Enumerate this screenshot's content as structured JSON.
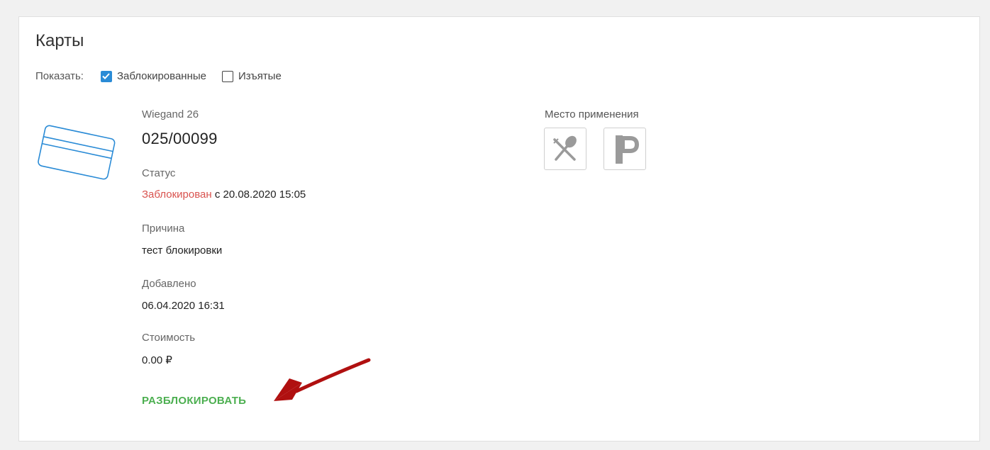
{
  "section": {
    "title": "Карты"
  },
  "filters": {
    "label": "Показать:",
    "blocked": {
      "label": "Заблокированные",
      "checked": true
    },
    "withdrawn": {
      "label": "Изъятые",
      "checked": false
    }
  },
  "card": {
    "type": "Wiegand 26",
    "number": "025/00099",
    "status_label": "Статус",
    "status_value": "Заблокирован",
    "status_since": "с 20.08.2020 15:05",
    "reason_label": "Причина",
    "reason_value": "тест блокировки",
    "added_label": "Добавлено",
    "added_value": "06.04.2020 16:31",
    "cost_label": "Стоимость",
    "cost_value": "0.00 ₽",
    "unblock_label": "РАЗБЛОКИРОВАТЬ"
  },
  "usage": {
    "label": "Место применения",
    "places": [
      {
        "icon": "restaurant-icon"
      },
      {
        "icon": "parking-icon"
      }
    ]
  },
  "colors": {
    "accent_blue": "#2a8bd6",
    "status_red": "#d9534f",
    "action_green": "#4caf50",
    "annotation_arrow": "#b01010"
  }
}
